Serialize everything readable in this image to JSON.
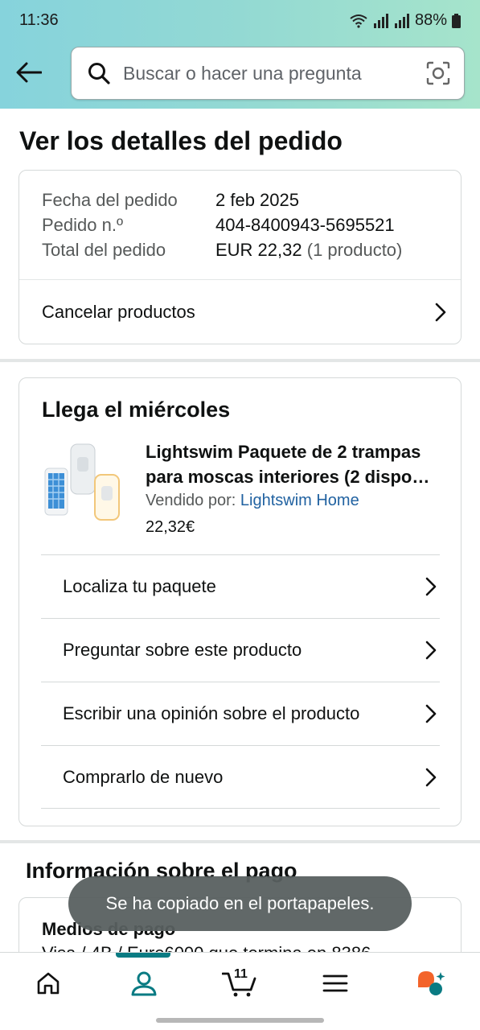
{
  "status_bar": {
    "time": "11:36",
    "battery": "88%"
  },
  "header": {
    "search_placeholder": "Buscar o hacer una pregunta"
  },
  "page_title": "Ver los detalles del pedido",
  "order": {
    "date_label": "Fecha del pedido",
    "date_value": "2 feb 2025",
    "number_label": "Pedido n.º",
    "number_value": "404-8400943-5695521",
    "total_label": "Total del pedido",
    "total_value": "EUR 22,32",
    "total_note": "(1 producto)",
    "cancel_label": "Cancelar productos"
  },
  "shipment": {
    "heading": "Llega el miércoles",
    "product_title": "Lightswim Paquete de 2 trampas para moscas interiores (2 dispo…",
    "sold_by_label": "Vendido por:",
    "seller": "Lightswim Home",
    "price": "22,32€",
    "actions": [
      {
        "label": "Localiza tu paquete"
      },
      {
        "label": "Preguntar sobre este producto"
      },
      {
        "label": "Escribir una opinión sobre el producto"
      },
      {
        "label": "Comprarlo de nuevo"
      }
    ]
  },
  "payment": {
    "heading": "Información sobre el pago",
    "methods_label": "Medios de pago",
    "methods_text": "Visa / 4B / Euro6000 que termina en 8386"
  },
  "toast": "Se ha copiado en el portapapeles.",
  "bottom_nav": {
    "cart_count": "11",
    "active_tab": "account"
  },
  "colors": {
    "accent": "#0a7b83",
    "link": "#2162a1",
    "header_gradient_start": "#86d3dc",
    "header_gradient_end": "#a6e4cb"
  }
}
